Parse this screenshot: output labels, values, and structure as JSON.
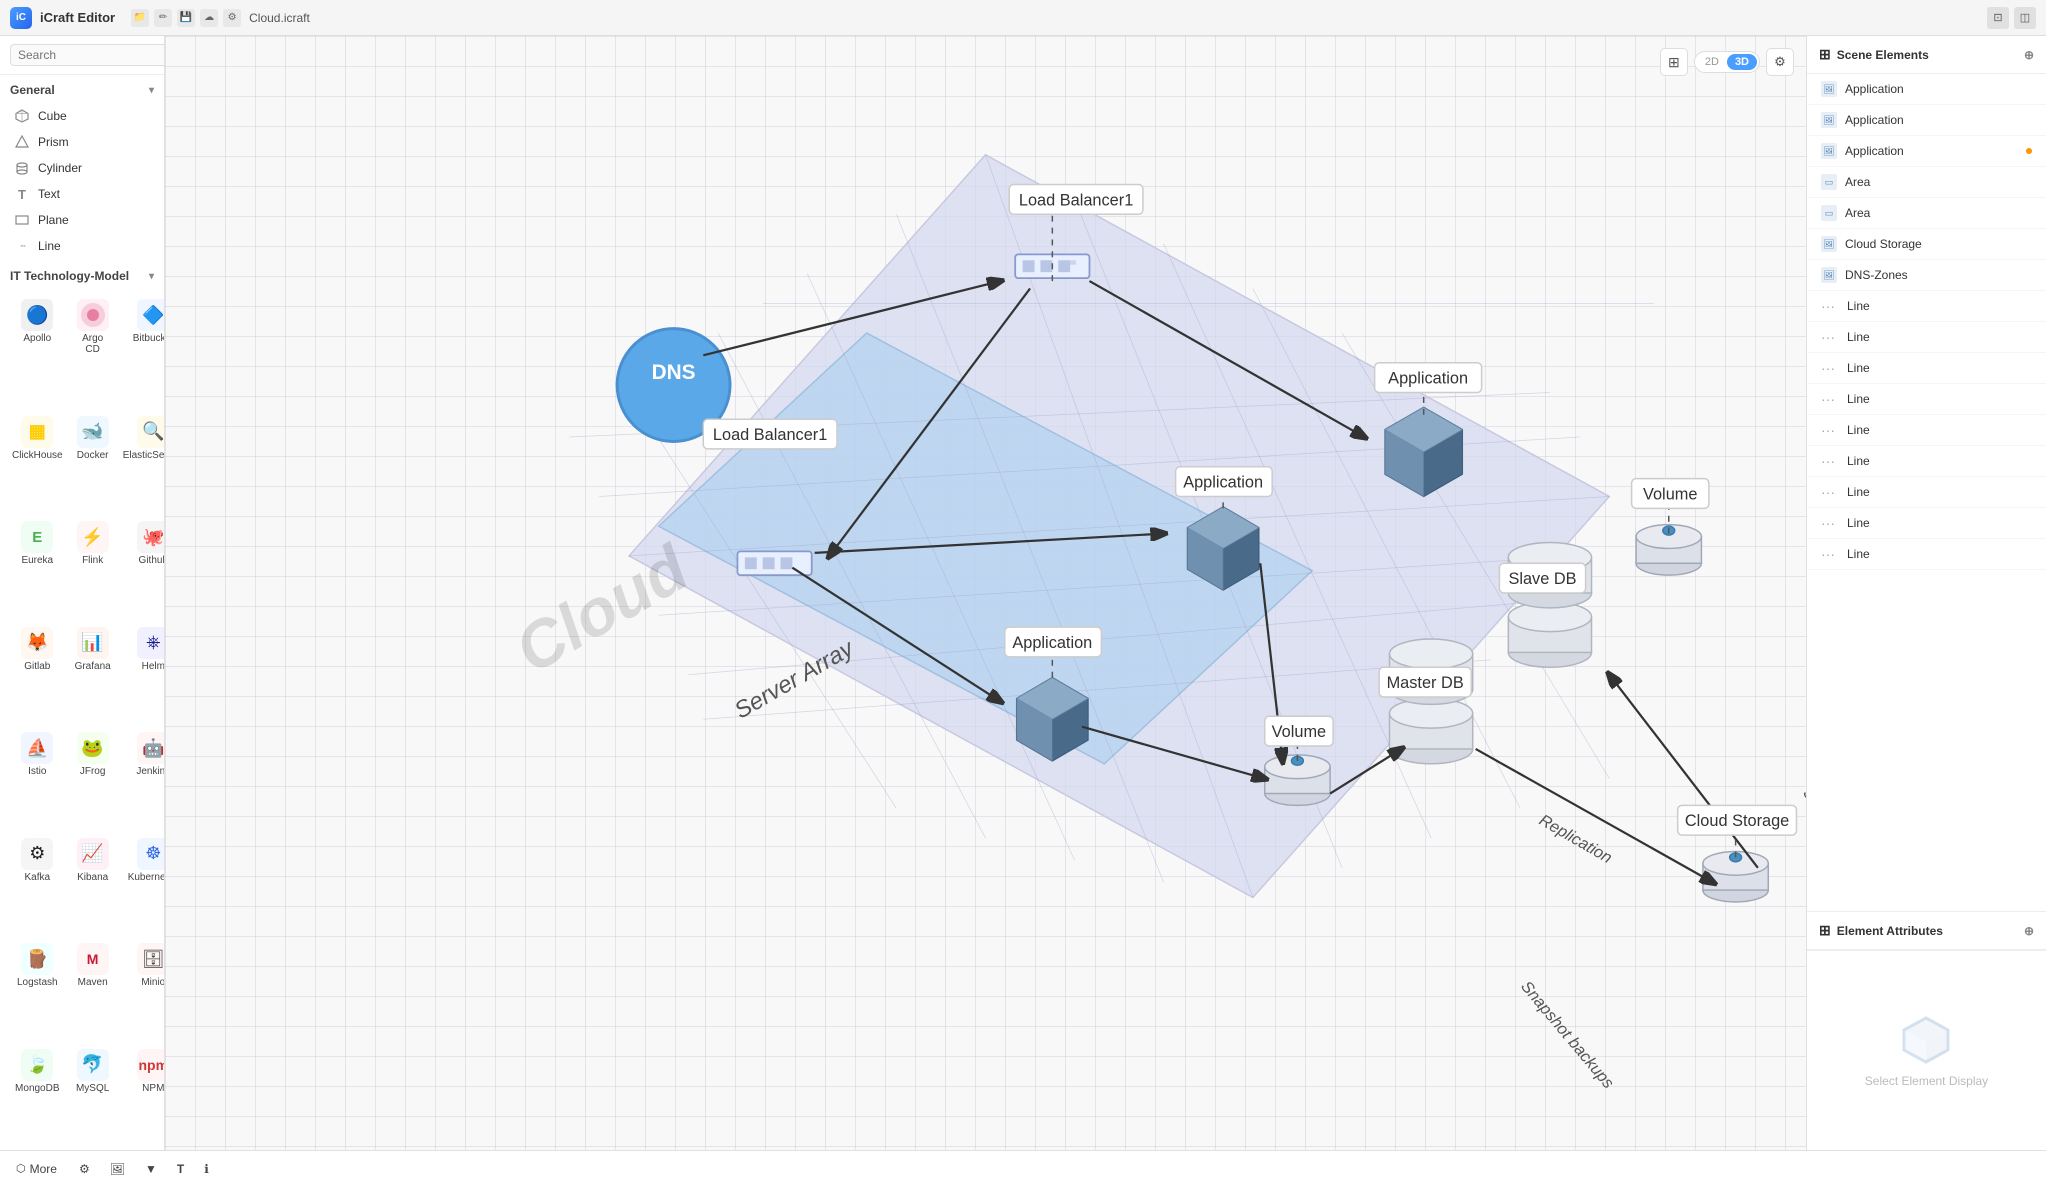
{
  "titlebar": {
    "app_icon": "iC",
    "app_title": "iCraft Editor",
    "filename": "Cloud.icraft",
    "window_btn1": "⊡",
    "window_btn2": "◫"
  },
  "search": {
    "placeholder": "Search"
  },
  "general_section": {
    "label": "General",
    "items": [
      {
        "name": "Cube",
        "icon": "◻"
      },
      {
        "name": "Prism",
        "icon": "△"
      },
      {
        "name": "Cylinder",
        "icon": "⬭"
      },
      {
        "name": "Text",
        "icon": "T"
      },
      {
        "name": "Plane",
        "icon": "⬜"
      },
      {
        "name": "Line",
        "icon": "—"
      }
    ]
  },
  "tech_section": {
    "label": "IT Technology-Model",
    "items": [
      {
        "name": "Apollo",
        "color": "#333",
        "bg": "#f5f5f5",
        "emoji": "🔵"
      },
      {
        "name": "Argo CD",
        "color": "#e97fa0",
        "bg": "#fff0f5",
        "emoji": "🟣"
      },
      {
        "name": "Bitbucket",
        "color": "#2563eb",
        "bg": "#eff6ff",
        "emoji": "🔷"
      },
      {
        "name": "ClickHouse",
        "color": "#ffcc00",
        "bg": "#fffbeb",
        "emoji": "🟡"
      },
      {
        "name": "Docker",
        "color": "#2496ed",
        "bg": "#eff8ff",
        "emoji": "🐋"
      },
      {
        "name": "ElasticSearch",
        "color": "#f0c040",
        "bg": "#fffbeb",
        "emoji": "🔍"
      },
      {
        "name": "Eureka",
        "color": "#4caf50",
        "bg": "#f0fdf4",
        "emoji": "🟢"
      },
      {
        "name": "Flink",
        "color": "#e8473f",
        "bg": "#fff5f5",
        "emoji": "⚡"
      },
      {
        "name": "Github",
        "color": "#333",
        "bg": "#f5f5f5",
        "emoji": "🐙"
      },
      {
        "name": "Gitlab",
        "color": "#fc6d26",
        "bg": "#fff7f0",
        "emoji": "🦊"
      },
      {
        "name": "Grafana",
        "color": "#e05a38",
        "bg": "#fff5f0",
        "emoji": "📊"
      },
      {
        "name": "Helm",
        "color": "#0f1689",
        "bg": "#f0f0ff",
        "emoji": "⎈"
      },
      {
        "name": "Istio",
        "color": "#466bb0",
        "bg": "#f0f5ff",
        "emoji": "🔗"
      },
      {
        "name": "JFrog",
        "color": "#6db33f",
        "bg": "#f5fff0",
        "emoji": "🐸"
      },
      {
        "name": "Jenkins",
        "color": "#d43f38",
        "bg": "#fff5f5",
        "emoji": "🤖"
      },
      {
        "name": "Kafka",
        "color": "#231f20",
        "bg": "#f5f5f5",
        "emoji": "⚙"
      },
      {
        "name": "Kibana",
        "color": "#e8488a",
        "bg": "#fff0f8",
        "emoji": "📈"
      },
      {
        "name": "Kubernetes",
        "color": "#326ce5",
        "bg": "#eff6ff",
        "emoji": "☸"
      },
      {
        "name": "Logstash",
        "color": "#00bfb3",
        "bg": "#f0ffff",
        "emoji": "🪵"
      },
      {
        "name": "Maven",
        "color": "#c71a36",
        "bg": "#fff5f5",
        "emoji": "M"
      },
      {
        "name": "Minio",
        "color": "#c72e49",
        "bg": "#fff5f5",
        "emoji": "🗄"
      },
      {
        "name": "MongoDB",
        "color": "#4caf50",
        "bg": "#f0fdf4",
        "emoji": "🍃"
      },
      {
        "name": "MySQL",
        "color": "#00618a",
        "bg": "#f0f8ff",
        "emoji": "🐬"
      },
      {
        "name": "NPM",
        "color": "#cb3837",
        "bg": "#fff5f5",
        "emoji": "📦"
      }
    ]
  },
  "bottom_toolbar": {
    "more_label": "More",
    "icons": [
      "⚙",
      "🖼",
      "▼",
      "T",
      "ℹ"
    ]
  },
  "canvas_controls": {
    "grid_icon": "⊞",
    "toggle_2d": "2D",
    "toggle_3d": "3D",
    "settings_icon": "⚙"
  },
  "right_panel": {
    "scene_title": "Scene Elements",
    "scene_items": [
      {
        "type": "image",
        "label": "Application",
        "dot": false
      },
      {
        "type": "image",
        "label": "Application",
        "dot": false
      },
      {
        "type": "image",
        "label": "Application",
        "dot": true
      },
      {
        "type": "area",
        "label": "Area",
        "dot": false
      },
      {
        "type": "area",
        "label": "Area",
        "dot": false
      },
      {
        "type": "image",
        "label": "Cloud Storage",
        "dot": false
      },
      {
        "type": "image",
        "label": "DNS-Zones",
        "dot": false
      },
      {
        "type": "line",
        "label": "Line",
        "dot": false
      },
      {
        "type": "line",
        "label": "Line",
        "dot": false
      },
      {
        "type": "line",
        "label": "Line",
        "dot": false
      },
      {
        "type": "line",
        "label": "Line",
        "dot": false
      },
      {
        "type": "line",
        "label": "Line",
        "dot": false
      },
      {
        "type": "line",
        "label": "Line",
        "dot": false
      },
      {
        "type": "line",
        "label": "Line",
        "dot": false
      },
      {
        "type": "line",
        "label": "Line",
        "dot": false
      },
      {
        "type": "line",
        "label": "Line",
        "dot": false
      }
    ],
    "attr_title": "Element Attributes",
    "attr_placeholder": "Select Element Display"
  },
  "diagram": {
    "dns_label": "DNS",
    "load_balancer1_top": "Load Balancer1",
    "load_balancer1_bottom": "Load Balancer1",
    "application1": "Application",
    "application2": "Application",
    "application3": "Application",
    "master_db": "Master DB",
    "slave_db": "Slave DB",
    "volume1": "Volume",
    "volume2": "Volume",
    "cloud_storage": "Cloud Storage",
    "replication": "Replication",
    "snapshot1": "Snapshot backups",
    "snapshot2": "Snapshot backups",
    "watermark": "Cloud",
    "server_array": "Server Array"
  }
}
